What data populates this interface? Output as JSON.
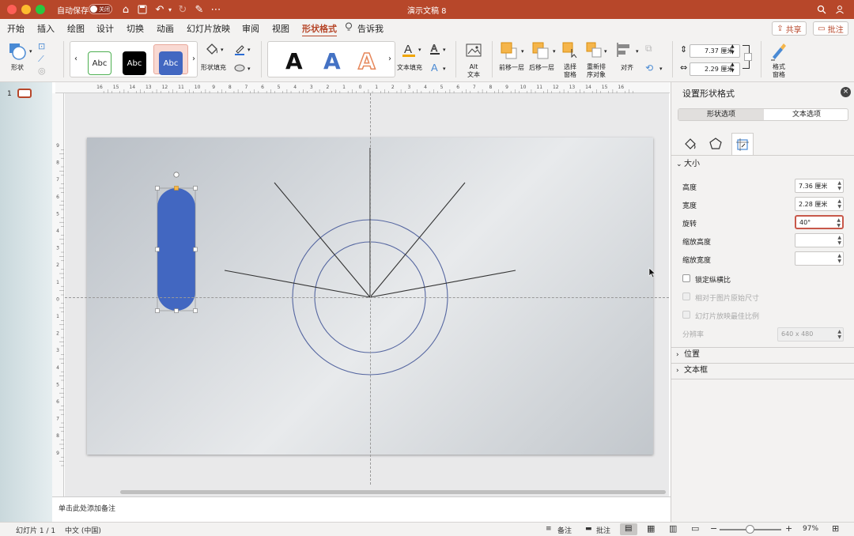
{
  "titlebar": {
    "autosave_label": "自动保存",
    "autosave_state": "关闭",
    "doc_title": "演示文稿 8"
  },
  "menu": {
    "tabs": [
      "开始",
      "插入",
      "绘图",
      "设计",
      "切换",
      "动画",
      "幻灯片放映",
      "审阅",
      "视图",
      "形状格式"
    ],
    "tell_me": "告诉我",
    "share": "共享",
    "comments": "批注",
    "active_tab": "形状格式"
  },
  "ribbon": {
    "shape_label": "形状",
    "styles": [
      "Abc",
      "Abc",
      "Abc"
    ],
    "shape_fill_label": "形状填充",
    "wordart_glyph": "A",
    "text_fill_label": "文本填充",
    "alt_text_label": "Alt 文本",
    "bring_forward": "前移一层",
    "send_backward": "后移一层",
    "selection_pane": "选择 窗格",
    "reorder_objects": "重新排 序对象",
    "align": "对齐",
    "height_value": "7.37 厘米",
    "width_value": "2.29 厘米",
    "format_pane": "格式 窗格"
  },
  "slides_pane": {
    "slide_number": "1"
  },
  "ruler": {
    "h_ticks": [
      "16",
      "15",
      "14",
      "13",
      "12",
      "11",
      "10",
      "9",
      "8",
      "7",
      "6",
      "5",
      "4",
      "3",
      "2",
      "1",
      "0",
      "1",
      "2",
      "3",
      "4",
      "5",
      "6",
      "7",
      "8",
      "9",
      "10",
      "11",
      "12",
      "13",
      "14",
      "15",
      "16"
    ],
    "v_ticks": [
      "9",
      "8",
      "7",
      "6",
      "5",
      "4",
      "3",
      "2",
      "1",
      "0",
      "1",
      "2",
      "3",
      "4",
      "5",
      "6",
      "7",
      "8",
      "9"
    ]
  },
  "notes": {
    "placeholder": "单击此处添加备注"
  },
  "panel": {
    "title": "设置形状格式",
    "tab_shape": "形状选项",
    "tab_text": "文本选项",
    "size_section": "大小",
    "height_label": "高度",
    "height_value": "7.36 厘米",
    "width_label": "宽度",
    "width_value": "2.28 厘米",
    "rotation_label": "旋转",
    "rotation_value": "40°",
    "scale_height_label": "缩放高度",
    "scale_width_label": "缩放宽度",
    "lock_aspect": "锁定纵横比",
    "relative_original": "相对于图片原始尺寸",
    "best_scale": "幻灯片放映最佳比例",
    "resolution_label": "分辨率",
    "resolution_value": "640 x 480",
    "position_section": "位置",
    "textbox_section": "文本框"
  },
  "status": {
    "slide_count": "幻灯片 1 / 1",
    "language": "中文 (中国)",
    "notes": "备注",
    "comments": "批注",
    "zoom": "97%"
  },
  "colors": {
    "accent": "#b7472a",
    "shape_fill": "#4267c1",
    "circle_stroke": "#5566a0"
  }
}
